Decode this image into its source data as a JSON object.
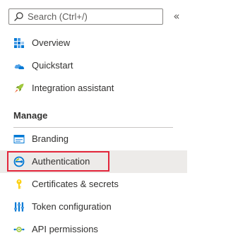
{
  "search": {
    "placeholder": "Search (Ctrl+/)"
  },
  "collapse": {
    "glyph": "«"
  },
  "nav": {
    "top_items": [
      {
        "label": "Overview",
        "icon": "overview-icon"
      },
      {
        "label": "Quickstart",
        "icon": "quickstart-icon"
      },
      {
        "label": "Integration assistant",
        "icon": "rocket-icon"
      }
    ],
    "manage_header": "Manage",
    "manage_items": [
      {
        "label": "Branding",
        "icon": "branding-icon"
      },
      {
        "label": "Authentication",
        "icon": "authentication-icon",
        "selected": true
      },
      {
        "label": "Certificates & secrets",
        "icon": "key-icon"
      },
      {
        "label": "Token configuration",
        "icon": "token-icon"
      },
      {
        "label": "API permissions",
        "icon": "api-permissions-icon"
      }
    ]
  },
  "colors": {
    "highlight_border": "#e3263b",
    "selected_bg": "#edebe9",
    "accent_blue": "#0078d4"
  }
}
